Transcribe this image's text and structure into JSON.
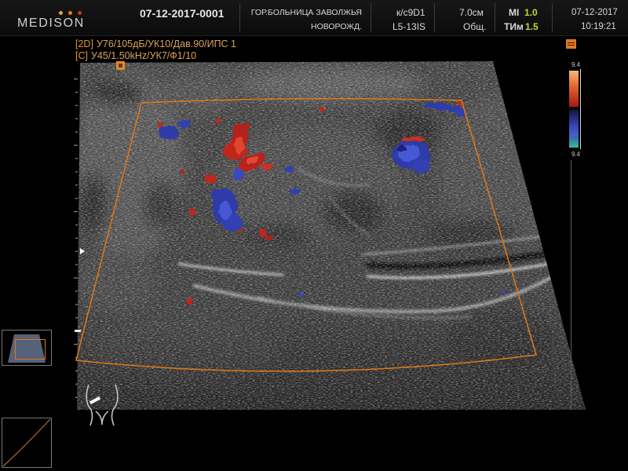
{
  "header": {
    "logo": "MEDISON",
    "patient_id": "07-12-2017-0001",
    "institution": "ГОР.БОЛЬНИЦА ЗАВОЛЖЬЯ",
    "patient_category": "НОВОРОЖД.",
    "preset": "к/с9D1",
    "probe": "L5-13IS",
    "depth": "7.0см",
    "application": "Общ.",
    "mi_label": "MI",
    "mi_value": "1.0",
    "ti_label": "ТИм",
    "ti_value": "1.5",
    "date": "07-12-2017",
    "time": "10:19:21"
  },
  "imaging_params": {
    "b_mode_tag": "[2D]",
    "b_mode_values": "У76/105дБ/УК10/Дав.90/ИПС 1",
    "color_mode_tag": "[C]",
    "color_mode_values": "У45/1.50kHz/УК7/Ф1/10"
  },
  "color_scale": {
    "max_label": "9.4",
    "min_label": "9.4"
  },
  "icons": {
    "focus_marker": "focus-marker-icon",
    "color_mode_indicator": "color-mode-indicator-icon",
    "depth_pointer": "focus-pointer-icon",
    "body_marker": "body-marker-icon",
    "probe_position": "probe-position-icon",
    "gray_map": "gray-map-curve-icon"
  },
  "colors": {
    "background": "#000000",
    "header_text": "#d8d8d8",
    "index_value": "#c2d63c",
    "accent_orange": "#e07a1e",
    "doppler_red": "#c0261e",
    "doppler_blue": "#2e3aa8"
  }
}
